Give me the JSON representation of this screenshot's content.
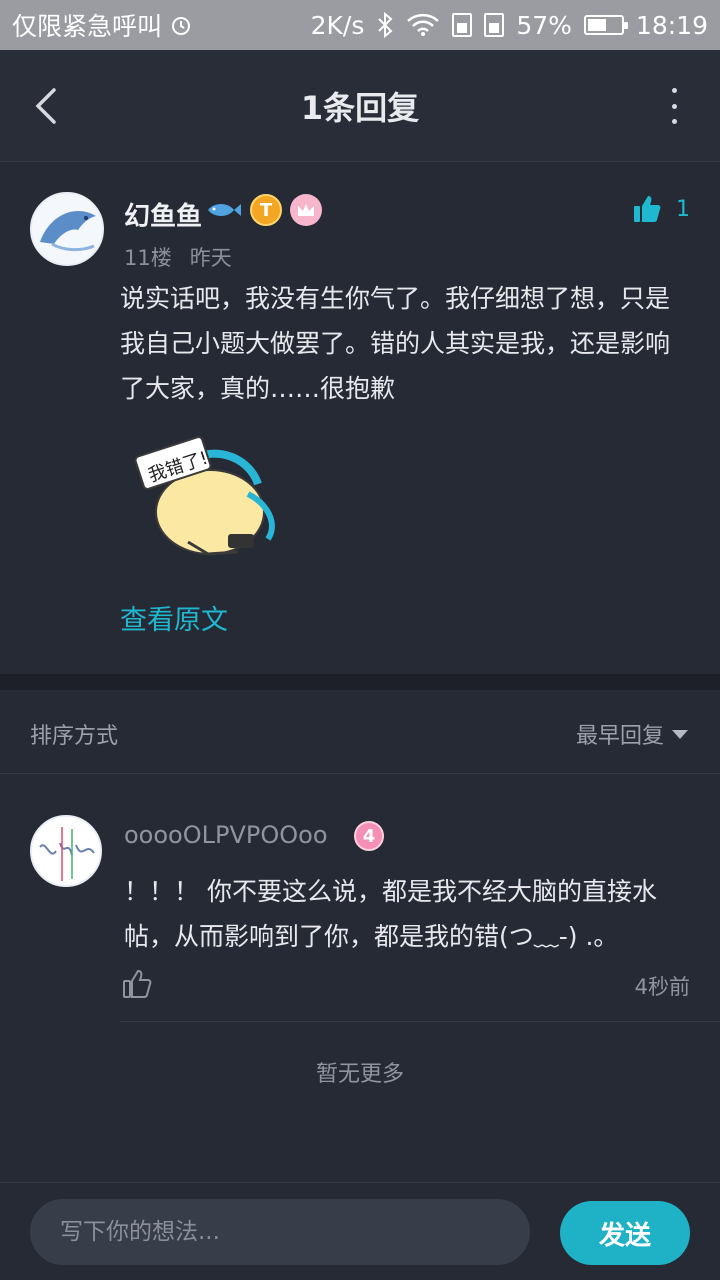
{
  "status_bar": {
    "carrier": "仅限紧急呼叫",
    "net_speed": "2K/s",
    "battery": "57%",
    "battery_level": 0.57,
    "time": "18:19"
  },
  "header": {
    "title": "1条回复"
  },
  "post": {
    "username": "幻鱼鱼",
    "badge_t": "T",
    "floor": "11楼",
    "time": "昨天",
    "like_count": "1",
    "content": "说实话吧，我没有生你气了。我仔细想了想，只是我自己小题大做罢了。错的人其实是我，还是影响了大家，真的……很抱歉",
    "sticker_text": "我错了!",
    "view_original": "查看原文"
  },
  "sort": {
    "label": "排序方式",
    "value": "最早回复"
  },
  "reply": {
    "username": "ooooOLPVPOOoo",
    "level": "4",
    "content": "！！！ 你不要这么说，都是我不经大脑的直接水帖，从而影响到了你，都是我的错(つ﹏-) .。",
    "time": "4秒前"
  },
  "no_more": "暂无更多",
  "composer": {
    "placeholder": "写下你的想法...",
    "send_label": "发送"
  },
  "colors": {
    "accent": "#1fb8d1",
    "background": "#262a35"
  }
}
